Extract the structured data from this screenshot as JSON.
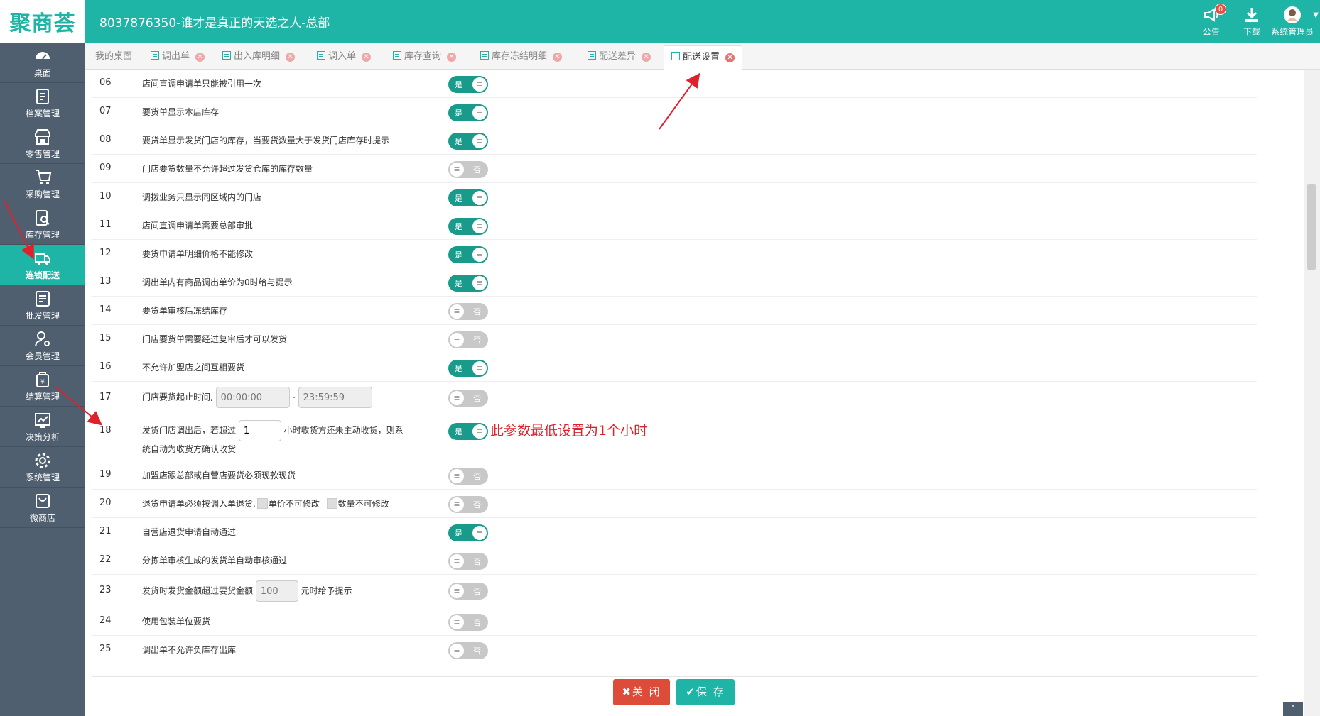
{
  "header": {
    "logo": "聚商荟",
    "title": "8037876350-谁才是真正的天选之人-总部",
    "notice_label": "公告",
    "notice_count": "0",
    "download_label": "下载",
    "user_label": "系统管理员"
  },
  "sidebar": {
    "items": [
      {
        "label": "桌面",
        "icon": "dashboard-icon"
      },
      {
        "label": "档案管理",
        "icon": "archive-icon"
      },
      {
        "label": "零售管理",
        "icon": "store-icon"
      },
      {
        "label": "采购管理",
        "icon": "cart-icon"
      },
      {
        "label": "库存管理",
        "icon": "inventory-icon"
      },
      {
        "label": "连锁配送",
        "icon": "truck-icon"
      },
      {
        "label": "批发管理",
        "icon": "wholesale-icon"
      },
      {
        "label": "会员管理",
        "icon": "member-icon"
      },
      {
        "label": "结算管理",
        "icon": "settlement-icon"
      },
      {
        "label": "决策分析",
        "icon": "chart-icon"
      },
      {
        "label": "系统管理",
        "icon": "gear-icon"
      },
      {
        "label": "微商店",
        "icon": "shop-bag-icon"
      }
    ]
  },
  "tabs": [
    {
      "label": "我的桌面"
    },
    {
      "label": "调出单"
    },
    {
      "label": "出入库明细"
    },
    {
      "label": "调入单"
    },
    {
      "label": "库存查询"
    },
    {
      "label": "库存冻结明细"
    },
    {
      "label": "配送差异"
    },
    {
      "label": "配送设置"
    }
  ],
  "toggle": {
    "on": "是",
    "off": "否"
  },
  "settings": [
    {
      "num": "06",
      "label": "店间直调申请单只能被引用一次",
      "on": true
    },
    {
      "num": "07",
      "label": "要货单显示本店库存",
      "on": true
    },
    {
      "num": "08",
      "label": "要货单显示发货门店的库存，当要货数量大于发货门店库存时提示",
      "on": true
    },
    {
      "num": "09",
      "label": "门店要货数量不允许超过发货仓库的库存数量",
      "on": false
    },
    {
      "num": "10",
      "label": "调拨业务只显示同区域内的门店",
      "on": true
    },
    {
      "num": "11",
      "label": "店间直调申请单需要总部审批",
      "on": true
    },
    {
      "num": "12",
      "label": "要货申请单明细价格不能修改",
      "on": true
    },
    {
      "num": "13",
      "label": "调出单内有商品调出单价为0时给与提示",
      "on": true
    },
    {
      "num": "14",
      "label": "要货单审核后冻结库存",
      "on": false
    },
    {
      "num": "15",
      "label": "门店要货单需要经过复审后才可以发货",
      "on": false
    },
    {
      "num": "16",
      "label": "不允许加盟店之间互相要货",
      "on": true
    },
    {
      "num": "17",
      "label_pre": "门店要货起止时间",
      "start": "00:00:00",
      "sep": "-",
      "end": "23:59:59",
      "on": false
    },
    {
      "num": "18",
      "label_pre": "发货门店调出后，若超过",
      "hours": "1",
      "label_post": "小时收货方还未主动收货，则系",
      "label_line2": "统自动为收货方确认收货",
      "on": true,
      "note": "此参数最低设置为1个小时"
    },
    {
      "num": "19",
      "label": "加盟店跟总部或自营店要货必须现款现货",
      "on": false
    },
    {
      "num": "20",
      "label_pre": "退货申请单必须按调入单退货,",
      "opt1": "单价不可修改",
      "opt2": "数量不可修改",
      "on": false
    },
    {
      "num": "21",
      "label": "自营店退货申请自动通过",
      "on": true
    },
    {
      "num": "22",
      "label": "分拣单审核生成的发货单自动审核通过",
      "on": false
    },
    {
      "num": "23",
      "label_pre": "发货时发货金额超过要货金额",
      "amount": "100",
      "label_post": "元时给予提示",
      "on": false
    },
    {
      "num": "24",
      "label": "使用包装单位要货",
      "on": false
    },
    {
      "num": "25",
      "label": "调出单不允许负库存出库",
      "on": false
    }
  ],
  "buttons": {
    "close": "关 闭",
    "save": "保 存"
  }
}
